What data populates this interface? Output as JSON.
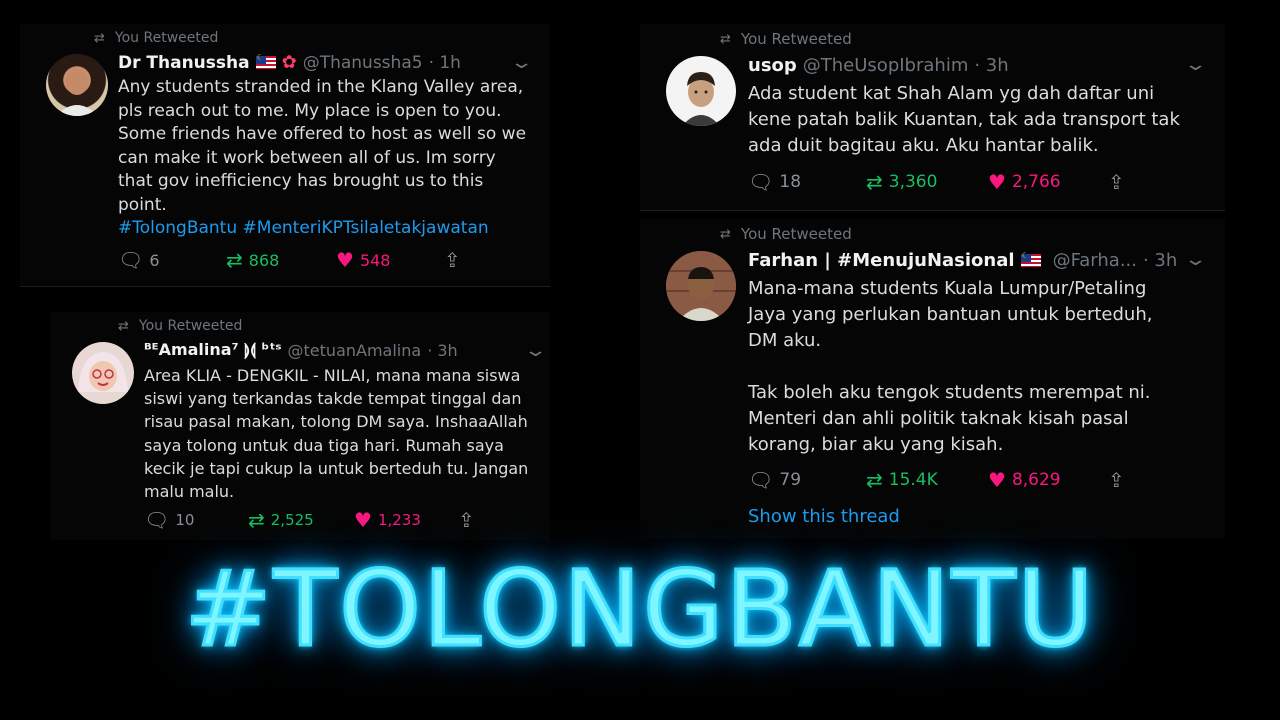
{
  "tweets": [
    {
      "retweeted": "You Retweeted",
      "name": "Dr Thanussha",
      "handle": "@Thanussha5",
      "time": "· 1h",
      "body": "Any students stranded in the Klang Valley area,\npls reach out to me. My place is open to you.\nSome friends have offered to host as well so we\ncan make it work between all of us. Im sorry\nthat gov inefficiency has brought us to this\npoint.",
      "hashtags": "#TolongBantu #MenteriKPTsilaletakjawatan",
      "replies": "6",
      "retweets": "868",
      "likes": "548"
    },
    {
      "retweeted": "You Retweeted",
      "name": "ᴮᴱAmalina⁷ ⟭⟬ ᵇᵗˢ",
      "handle": "@tetuanAmalina",
      "time": "· 3h",
      "body": "Area KLIA - DENGKIL - NILAI, mana mana siswa\nsiswi yang terkandas takde tempat tinggal dan\nrisau pasal makan, tolong DM saya. InshaaAllah\nsaya tolong untuk dua tiga hari. Rumah saya\nkecik je tapi cukup la untuk berteduh tu. Jangan\nmalu malu.",
      "replies": "10",
      "retweets": "2,525",
      "likes": "1,233"
    },
    {
      "retweeted": "You Retweeted",
      "name": "usop",
      "handle": "@TheUsopIbrahim",
      "time": "· 3h",
      "body": "Ada student kat Shah Alam yg dah daftar uni\nkene patah balik Kuantan, tak ada transport tak\nada duit bagitau aku. Aku hantar balik.",
      "replies": "18",
      "retweets": "3,360",
      "likes": "2,766"
    },
    {
      "retweeted": "You Retweeted",
      "name": "Farhan | #MenujuNasional",
      "handle": "@Farha...",
      "time": "· 3h",
      "body": "Mana-mana students Kuala Lumpur/Petaling\nJaya yang perlukan bantuan untuk berteduh,\nDM aku.\n\nTak boleh aku tengok students merempat ni.\nMenteri dan ahli politik taknak kisah pasal\nkorang, biar aku yang kisah.",
      "replies": "79",
      "retweets": "15.4K",
      "likes": "8,629",
      "show_thread": "Show this thread"
    }
  ],
  "overlay_title": "#TOLONGBANTU",
  "colors": {
    "retweet": "#17bf63",
    "like": "#f91880",
    "link": "#1d9bf0",
    "glow": "#00c8ff"
  }
}
